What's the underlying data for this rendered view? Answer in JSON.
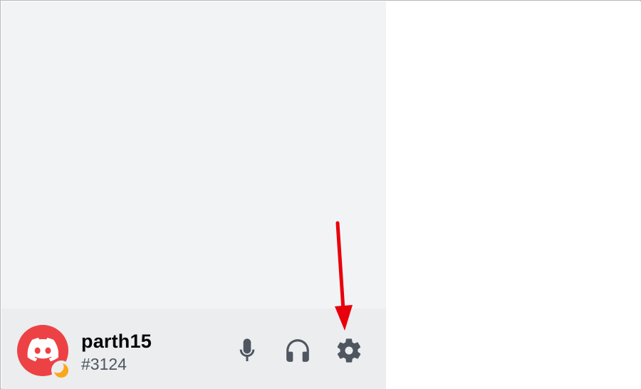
{
  "user_panel": {
    "username": "parth15",
    "discriminator": "#3124",
    "avatar_icon": "discord-logo-icon",
    "status_icon": "idle-moon-icon",
    "controls": {
      "mic_icon": "microphone-icon",
      "headset_icon": "headphones-icon",
      "settings_icon": "gear-icon"
    }
  },
  "annotation": {
    "icon": "red-arrow-icon",
    "color": "#e8000b"
  },
  "colors": {
    "sidebar_bg": "#f2f3f5",
    "panel_bg": "#ebedef",
    "avatar_bg": "#ed4245",
    "idle_status": "#faa81a",
    "icon_gray": "#4f5660"
  }
}
